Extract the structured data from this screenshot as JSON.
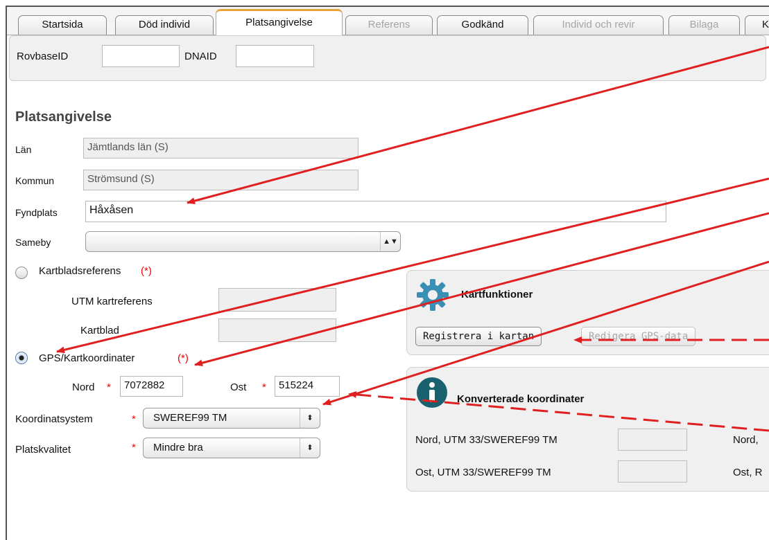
{
  "tabs": [
    "Startsida",
    "Död individ",
    "Platsangivelse",
    "Referens",
    "Godkänd",
    "Individ och revir",
    "Bilaga",
    "K"
  ],
  "ids": {
    "rovbase_label": "RovbaseID",
    "rovbase_value": "",
    "dna_label": "DNAID",
    "dna_value": ""
  },
  "section_title": "Platsangivelse",
  "lan": {
    "label": "Län",
    "value": "Jämtlands län (S)"
  },
  "kommun": {
    "label": "Kommun",
    "value": "Strömsund (S)"
  },
  "fyndplats": {
    "label": "Fyndplats",
    "value": "Håxåsen"
  },
  "sameby": {
    "label": "Sameby",
    "value": ""
  },
  "kartblad_option": {
    "label": "Kartbladsreferens",
    "req": "(*)",
    "utm_label": "UTM kartreferens",
    "kartblad_label": "Kartblad"
  },
  "gps_option": {
    "label": "GPS/Kartkoordinater",
    "req": "(*)"
  },
  "nord": {
    "label": "Nord",
    "star": "*",
    "value": "7072882"
  },
  "ost": {
    "label": "Ost",
    "star": "*",
    "value": "515224"
  },
  "koordinatsystem": {
    "label": "Koordinatsystem",
    "star": "*",
    "value": "SWEREF99 TM"
  },
  "platskvalitet": {
    "label": "Platskvalitet",
    "star": "*",
    "value": "Mindre bra"
  },
  "kartfunktioner": {
    "title": "Kartfunktioner",
    "register_button": "Registrera i kartan",
    "edit_button": "Redigera GPS-data",
    "icon": "gear-icon"
  },
  "konverterade": {
    "title": "Konverterade koordinater",
    "icon": "info-icon",
    "nord_utm": "Nord, UTM 33/SWEREF99 TM",
    "ost_utm": "Ost, UTM 33/SWEREF99 TM",
    "nord_right": "Nord,",
    "ost_right": "Ost, R"
  },
  "colors": {
    "annotation": "#e02020",
    "tab_accent": "#e8a33a"
  }
}
